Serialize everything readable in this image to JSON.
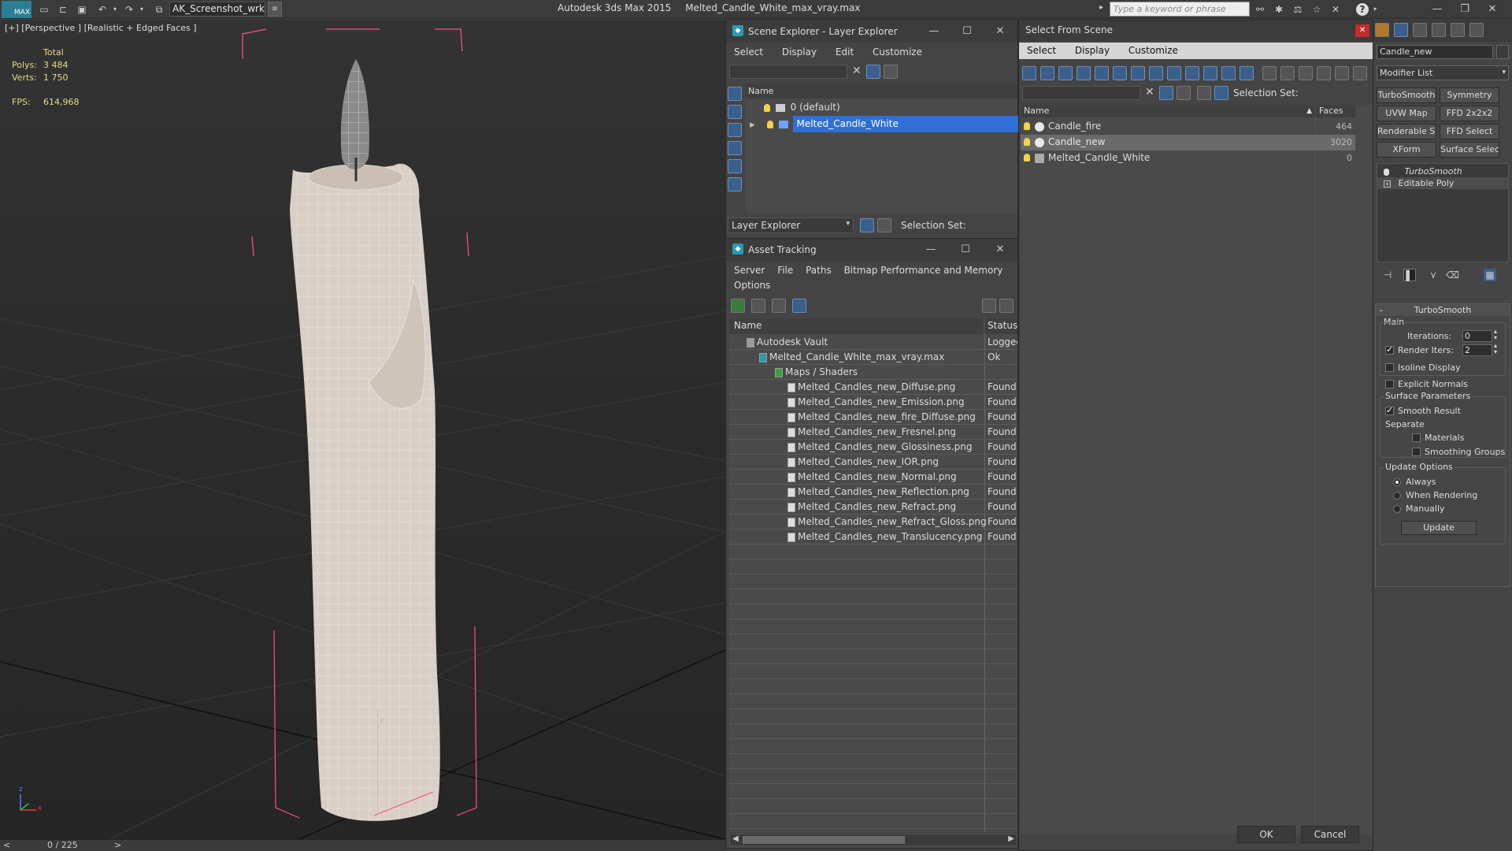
{
  "titlebar": {
    "logo": "MAX",
    "workspace": "AK_Screenshot_wrksp",
    "app_name": "Autodesk 3ds Max  2015",
    "file_name": "Melted_Candle_White_max_vray.max",
    "search_placeholder": "Type a keyword or phrase"
  },
  "viewport": {
    "label": "[+] [Perspective ] [Realistic + Edged Faces ]",
    "stats": {
      "total_label": "Total",
      "polys_label": "Polys:",
      "polys_value": "3 484",
      "verts_label": "Verts:",
      "verts_value": "1 750",
      "fps_label": "FPS:",
      "fps_value": "614,968"
    },
    "axis_z": "z",
    "axis_x": "x"
  },
  "timeline": {
    "frame": "0 / 225",
    "prev": "<",
    "next": ">"
  },
  "scene_explorer": {
    "title": "Scene Explorer - Layer Explorer",
    "menu": [
      "Select",
      "Display",
      "Edit",
      "Customize"
    ],
    "column_name": "Name",
    "layers": [
      {
        "name": "0 (default)",
        "selected": false
      },
      {
        "name": "Melted_Candle_White",
        "selected": true
      }
    ],
    "footer_dropdown": "Layer Explorer",
    "selection_set_label": "Selection Set:"
  },
  "asset_tracking": {
    "title": "Asset Tracking",
    "menu_row1": [
      "Server",
      "File",
      "Paths",
      "Bitmap Performance and Memory"
    ],
    "menu_row2": [
      "Options"
    ],
    "col_name": "Name",
    "col_status": "Status",
    "rows": [
      {
        "name": "Autodesk Vault",
        "status": "Logged",
        "level": 0
      },
      {
        "name": "Melted_Candle_White_max_vray.max",
        "status": "Ok",
        "level": 1
      },
      {
        "name": "Maps / Shaders",
        "status": "",
        "level": 2
      },
      {
        "name": "Melted_Candles_new_Diffuse.png",
        "status": "Found",
        "level": 3
      },
      {
        "name": "Melted_Candles_new_Emission.png",
        "status": "Found",
        "level": 3
      },
      {
        "name": "Melted_Candles_new_fire_Diffuse.png",
        "status": "Found",
        "level": 3
      },
      {
        "name": "Melted_Candles_new_Fresnel.png",
        "status": "Found",
        "level": 3
      },
      {
        "name": "Melted_Candles_new_Glossiness.png",
        "status": "Found",
        "level": 3
      },
      {
        "name": "Melted_Candles_new_IOR.png",
        "status": "Found",
        "level": 3
      },
      {
        "name": "Melted_Candles_new_Normal.png",
        "status": "Found",
        "level": 3
      },
      {
        "name": "Melted_Candles_new_Reflection.png",
        "status": "Found",
        "level": 3
      },
      {
        "name": "Melted_Candles_new_Refract.png",
        "status": "Found",
        "level": 3
      },
      {
        "name": "Melted_Candles_new_Refract_Gloss.png",
        "status": "Found",
        "level": 3
      },
      {
        "name": "Melted_Candles_new_Translucency.png",
        "status": "Found",
        "level": 3
      }
    ]
  },
  "select_from_scene": {
    "title": "Select From Scene",
    "menu": [
      "Select",
      "Display",
      "Customize"
    ],
    "selection_set_label": "Selection Set:",
    "col_name": "Name",
    "col_faces": "Faces",
    "rows": [
      {
        "name": "Candle_fire",
        "faces": "464",
        "selected": false
      },
      {
        "name": "Candle_new",
        "faces": "3020",
        "selected": true
      },
      {
        "name": "Melted_Candle_White",
        "faces": "0",
        "selected": false
      }
    ],
    "ok_label": "OK",
    "cancel_label": "Cancel"
  },
  "command_panel": {
    "object_name": "Candle_new",
    "modifier_list": "Modifier List",
    "buttons": [
      "TurboSmooth",
      "Symmetry",
      "UVW Map",
      "FFD 2x2x2",
      "Renderable Spline",
      "FFD Select",
      "XForm",
      "Surface Select"
    ],
    "stack": [
      "TurboSmooth",
      "Editable Poly"
    ],
    "rollout_title": "TurboSmooth",
    "main_label": "Main",
    "iterations_label": "Iterations:",
    "iterations_value": "0",
    "render_iters_label": "Render Iters:",
    "render_iters_value": "2",
    "isoline_label": "Isoline Display",
    "explicit_normals_label": "Explicit Normals",
    "surface_params_label": "Surface Parameters",
    "smooth_result_label": "Smooth Result",
    "separate_label": "Separate",
    "materials_label": "Materials",
    "smoothing_groups_label": "Smoothing Groups",
    "update_options_label": "Update Options",
    "always_label": "Always",
    "when_rendering_label": "When Rendering",
    "manually_label": "Manually",
    "update_button": "Update"
  },
  "colors": {
    "selection_blue": "#2f6fd6",
    "candle": "#d9cfc6",
    "bbox_pink": "#ff4f8f",
    "stats_yellow": "#e6d98a"
  }
}
